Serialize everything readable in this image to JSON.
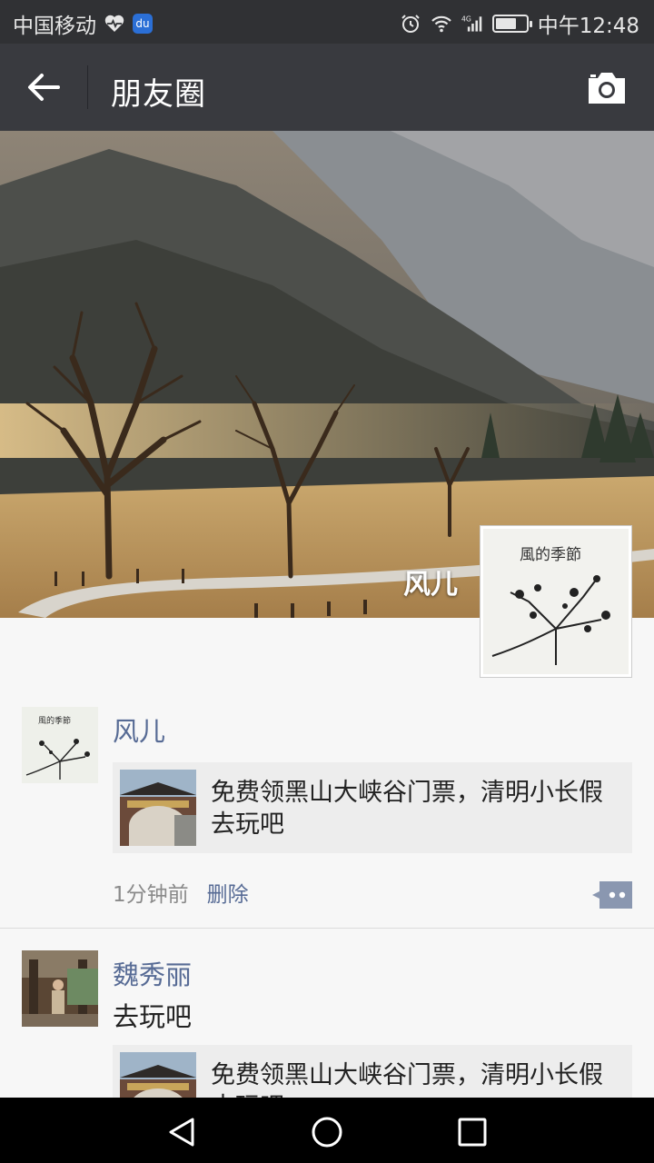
{
  "status_bar": {
    "carrier": "中国移动",
    "network": "4G",
    "time": "中午12:48",
    "battery_level": 0.7,
    "icons": [
      "heart-monitor-icon",
      "baidu-paw-icon",
      "alarm-icon",
      "wifi-icon",
      "signal-icon",
      "battery-icon"
    ]
  },
  "header": {
    "title": "朋友圈",
    "back_icon": "back-arrow-icon",
    "camera_icon": "camera-icon"
  },
  "cover": {
    "user_name": "风儿",
    "avatar_text": "風的季節"
  },
  "feed": [
    {
      "name": "风儿",
      "text": "",
      "share_title": "免费领黑山大峡谷门票，清明小长假去玩吧",
      "time": "1分钟前",
      "delete_label": "删除"
    },
    {
      "name": "魏秀丽",
      "text": "去玩吧",
      "share_title": "免费领黑山大峡谷门票，清明小长假去玩吧"
    }
  ],
  "colors": {
    "header_bg": "#393a3f",
    "status_bg": "#303134",
    "name_link": "#576b95",
    "page_bg": "#f7f7f7"
  }
}
